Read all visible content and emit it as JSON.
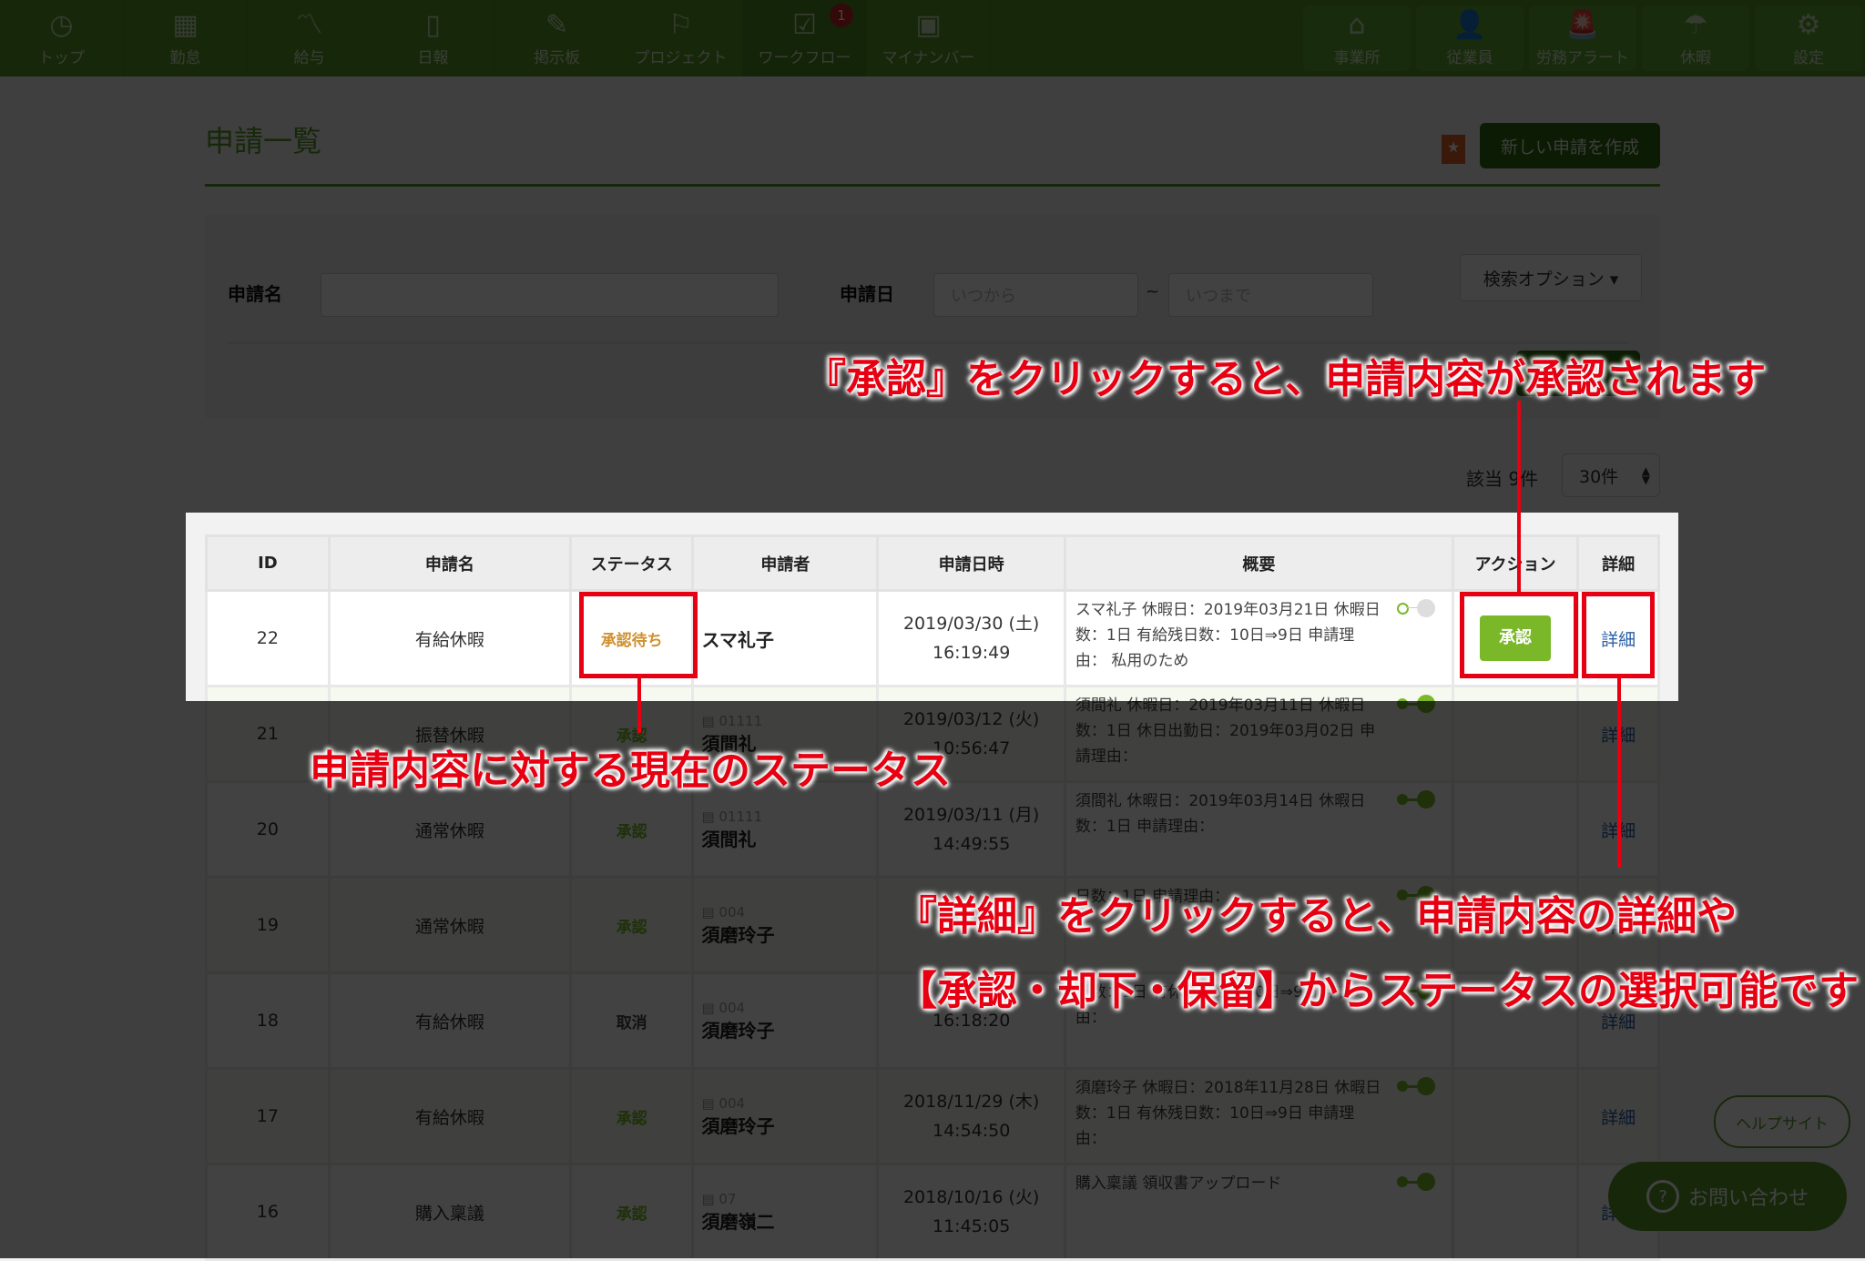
{
  "nav": {
    "left": [
      {
        "label": "トップ",
        "icon": "clock-icon",
        "glyph": "◷"
      },
      {
        "label": "勤怠",
        "icon": "calendar-icon",
        "glyph": "▦"
      },
      {
        "label": "給与",
        "icon": "chart-line-icon",
        "glyph": "〽"
      },
      {
        "label": "日報",
        "icon": "document-icon",
        "glyph": "▯"
      },
      {
        "label": "掲示板",
        "icon": "notes-icon",
        "glyph": "✎"
      },
      {
        "label": "プロジェクト",
        "icon": "flag-icon",
        "glyph": "⚐"
      },
      {
        "label": "ワークフロー",
        "icon": "checklist-icon",
        "glyph": "☑",
        "badge": "1"
      },
      {
        "label": "マイナンバー",
        "icon": "id-card-icon",
        "glyph": "▣"
      }
    ],
    "right": [
      {
        "label": "事業所",
        "icon": "home-icon",
        "glyph": "⌂"
      },
      {
        "label": "従業員",
        "icon": "user-icon",
        "glyph": "👤"
      },
      {
        "label": "労務アラート",
        "icon": "alert-light-icon",
        "glyph": "🚨"
      },
      {
        "label": "休暇",
        "icon": "umbrella-icon",
        "glyph": "☂"
      },
      {
        "label": "設定",
        "icon": "gear-icon",
        "glyph": "⚙"
      }
    ]
  },
  "page": {
    "title": "申請一覧",
    "new_button": "新しい申請を作成",
    "star": "★"
  },
  "search": {
    "name_label": "申請名",
    "name_value": "",
    "date_label": "申請日",
    "from_placeholder": "いつから",
    "tilde": "~",
    "to_placeholder": "いつまで",
    "options_button": "検索オプション ▾",
    "search_button": "検索"
  },
  "results": {
    "count": "該当 9件",
    "per_page": "30件"
  },
  "table": {
    "headers": [
      "ID",
      "申請名",
      "ステータス",
      "申請者",
      "申請日時",
      "概要",
      "アクション",
      "詳細"
    ],
    "rows": [
      {
        "id": "22",
        "name": "有給休暇",
        "status": "承認待ち",
        "status_type": "pending",
        "emp_no": "",
        "applicant": "スマ礼子",
        "date": "2019/03/30 (土)",
        "time": "16:19:49",
        "summary": "スマ礼子 休暇日：2019年03月21日 休暇日数：1日 有給残日数：10日⇒9日 申請理由： 私用のため",
        "action": "承認",
        "detail": "詳細"
      },
      {
        "id": "21",
        "name": "振替休暇",
        "status": "承認",
        "status_type": "approved",
        "emp_no": "01111",
        "applicant": "須間礼",
        "date": "2019/03/12 (火)",
        "time": "10:56:47",
        "summary": "須間礼 休暇日：2019年03月11日 休暇日数：1日 休日出勤日：2019年03月02日 申請理由：",
        "action": "",
        "detail": "詳細"
      },
      {
        "id": "20",
        "name": "通常休暇",
        "status": "承認",
        "status_type": "approved",
        "emp_no": "01111",
        "applicant": "須間礼",
        "date": "2019/03/11 (月)",
        "time": "14:49:55",
        "summary": "須間礼 休暇日：2019年03月14日 休暇日数：1日 申請理由：",
        "action": "",
        "detail": "詳細"
      },
      {
        "id": "19",
        "name": "通常休暇",
        "status": "承認",
        "status_type": "approved",
        "emp_no": "004",
        "applicant": "須磨玲子",
        "date": "",
        "time": "",
        "summary": "日数：1日 申請理由：",
        "action": "",
        "detail": "詳細"
      },
      {
        "id": "18",
        "name": "有給休暇",
        "status": "取消",
        "status_type": "cancel",
        "emp_no": "004",
        "applicant": "須磨玲子",
        "date": "",
        "time": "16:18:20",
        "summary": "日数：1日 有休残日数：10日⇒9日 申請理由：",
        "action": "",
        "detail": "詳細"
      },
      {
        "id": "17",
        "name": "有給休暇",
        "status": "承認",
        "status_type": "approved",
        "emp_no": "004",
        "applicant": "須磨玲子",
        "date": "2018/11/29 (木)",
        "time": "14:54:50",
        "summary": "須磨玲子 休暇日：2018年11月28日 休暇日数：1日 有休残日数：10日⇒9日 申請理由：",
        "action": "",
        "detail": "詳細"
      },
      {
        "id": "16",
        "name": "購入稟議",
        "status": "承認",
        "status_type": "approved",
        "emp_no": "07",
        "applicant": "須磨嶺二",
        "date": "2018/10/16 (火)",
        "time": "11:45:05",
        "summary": "購入稟議 領収書アップロード",
        "action": "",
        "detail": "詳細"
      }
    ]
  },
  "floating": {
    "help": "ヘルプサイト",
    "contact": "お問い合わせ",
    "contact_icon": "?"
  },
  "annotations": {
    "approve": "『承認』をクリックすると、申請内容が承認されます",
    "status": "申請内容に対する現在のステータス",
    "detail_line1": "『詳細』をクリックすると、申請内容の詳細や",
    "detail_line2": "【承認・却下・保留】からステータスの選択可能です"
  },
  "colors": {
    "brand": "#5a9c2a",
    "annotation": "#e60012",
    "pending": "#d09030",
    "link": "#2b5fa8"
  }
}
